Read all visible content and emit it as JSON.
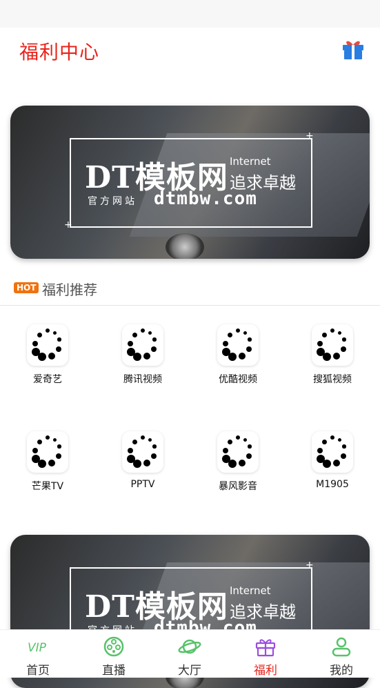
{
  "header": {
    "title": "福利中心",
    "gift_icon": "gift-icon"
  },
  "banner": {
    "brand": "DT模板网",
    "internet": "Internet",
    "slogan": "追求卓越",
    "official": "官方网站",
    "domain": "dtmbw.com"
  },
  "section": {
    "badge": "HOT",
    "title": "福利推荐"
  },
  "apps": [
    {
      "label": "爱奇艺"
    },
    {
      "label": "腾讯视频"
    },
    {
      "label": "优酷视频"
    },
    {
      "label": "搜狐视频"
    },
    {
      "label": "芒果TV"
    },
    {
      "label": "PPTV"
    },
    {
      "label": "暴风影音"
    },
    {
      "label": "M1905"
    }
  ],
  "tabs": [
    {
      "label": "首页",
      "icon": "vip-icon"
    },
    {
      "label": "直播",
      "icon": "film-reel-icon"
    },
    {
      "label": "大厅",
      "icon": "planet-icon"
    },
    {
      "label": "福利",
      "icon": "gift-icon"
    },
    {
      "label": "我的",
      "icon": "user-icon"
    }
  ],
  "colors": {
    "accent": "#e8231b",
    "hot": "#f0720f",
    "active_icon": "#9b4de0",
    "green": "#58c26a"
  },
  "active_tab": "福利"
}
